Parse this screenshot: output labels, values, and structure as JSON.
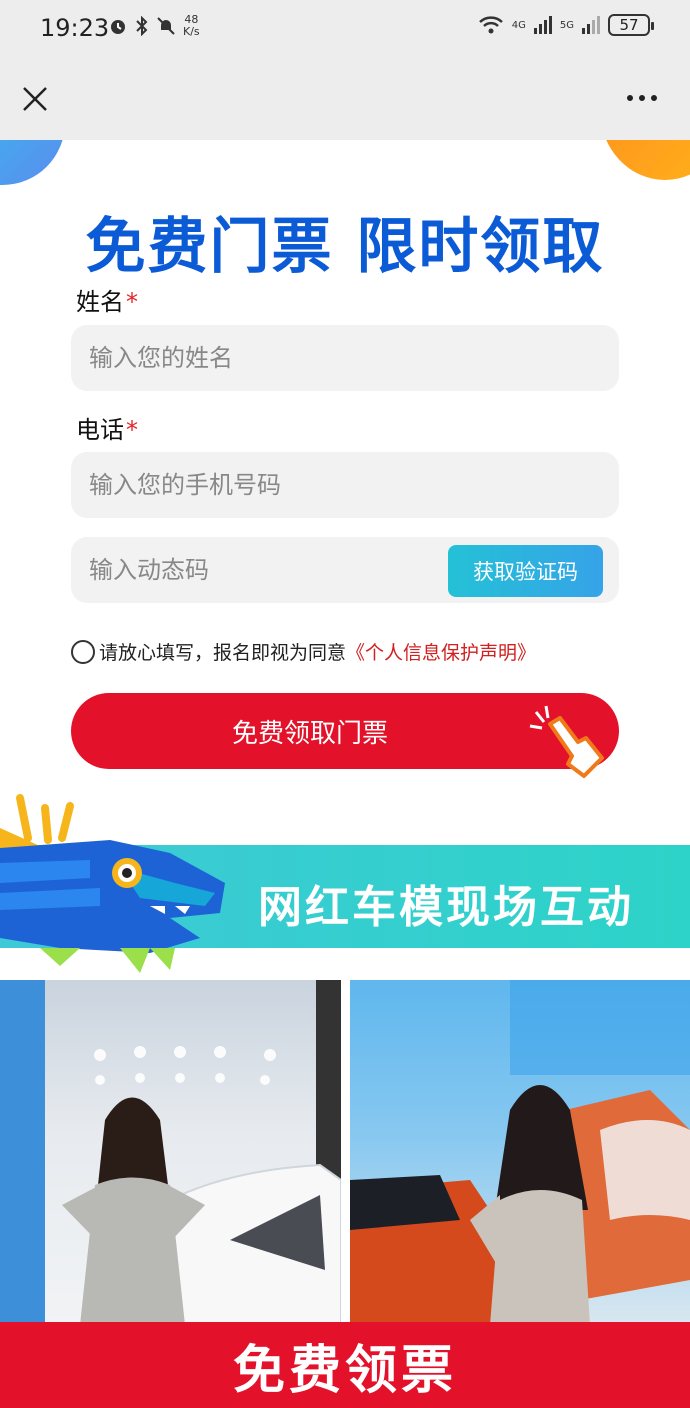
{
  "status_bar": {
    "time": "19:23",
    "speed_value": "48",
    "speed_unit": "K/s",
    "net1": "4G",
    "net2": "5G",
    "battery": "57"
  },
  "nav": {
    "close_icon": "close-icon",
    "more_icon": "more-icon"
  },
  "headline": "免费门票 限时领取",
  "form": {
    "name_label": "姓名",
    "name_placeholder": "输入您的姓名",
    "phone_label": "电话",
    "phone_placeholder": "输入您的手机号码",
    "code_placeholder": "输入动态码",
    "code_button": "获取验证码",
    "required_mark": "*",
    "agree_text": "请放心填写，报名即视为同意",
    "policy_link": "《个人信息保护声明》",
    "submit_label": "免费领取门票"
  },
  "banner": {
    "text": "网红车模现场互动"
  },
  "bottom_bar": {
    "label": "免费领票"
  },
  "colors": {
    "headline": "#0b5ad6",
    "primary_red": "#e3122a",
    "banner_teal": "#3ec9d6",
    "link_red": "#d0201f"
  }
}
